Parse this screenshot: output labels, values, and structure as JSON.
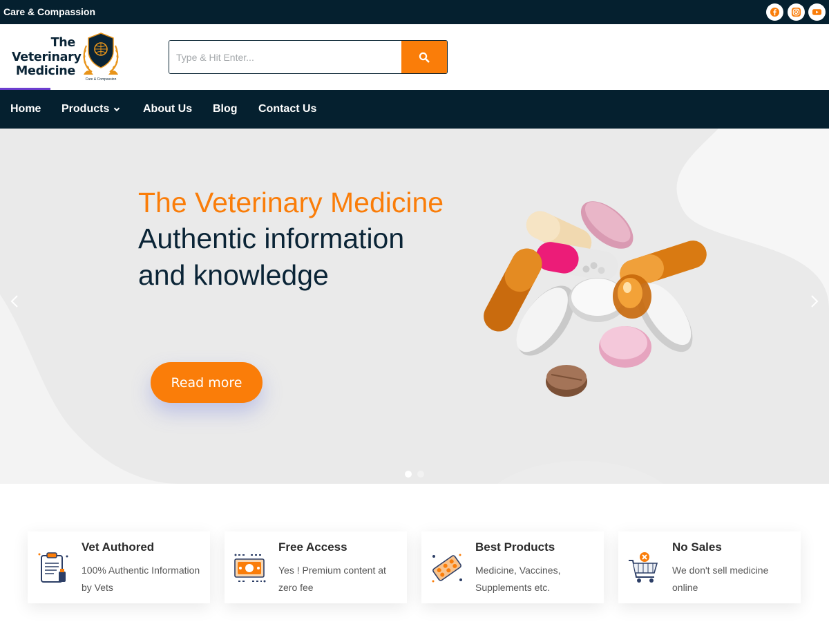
{
  "topbar": {
    "tagline": "Care & Compassion",
    "social": [
      {
        "name": "facebook-icon",
        "color": "#fa7d09"
      },
      {
        "name": "instagram-icon",
        "color": "#fa7d09"
      },
      {
        "name": "youtube-icon",
        "color": "#fa7d09"
      }
    ]
  },
  "header": {
    "logo_line1": "The",
    "logo_line2": "Veterinary",
    "logo_line3": "Medicine",
    "logo_emblem_text": "Care & Compassion",
    "search": {
      "placeholder": "Type & Hit Enter...",
      "button_icon": "search-icon"
    }
  },
  "nav": {
    "items": [
      {
        "label": "Home"
      },
      {
        "label": "Products",
        "icon": "chevron-down-icon"
      },
      {
        "label": "About Us"
      },
      {
        "label": "Blog"
      },
      {
        "label": "Contact Us"
      }
    ]
  },
  "hero": {
    "title": "The Veterinary Medicine",
    "subtitle_line1": "Authentic information",
    "subtitle_line2": "and knowledge",
    "cta_label": "Read more",
    "slides_total": 2,
    "active_slide": 1
  },
  "features": [
    {
      "title": "Vet Authored",
      "desc": "100% Authentic Information by Vets",
      "icon": "clipboard-icon"
    },
    {
      "title": "Free Access",
      "desc": "Yes ! Premium content at zero fee",
      "icon": "money-icon"
    },
    {
      "title": "Best Products",
      "desc": "Medicine, Vaccines, Supplements etc.",
      "icon": "pill-strip-icon"
    },
    {
      "title": "No Sales",
      "desc": "We don't sell medicine online",
      "icon": "cart-cancel-icon"
    }
  ],
  "colors": {
    "brand_dark": "#05202f",
    "accent": "#fa7d09",
    "nav_accent": "#6c3ecf"
  }
}
